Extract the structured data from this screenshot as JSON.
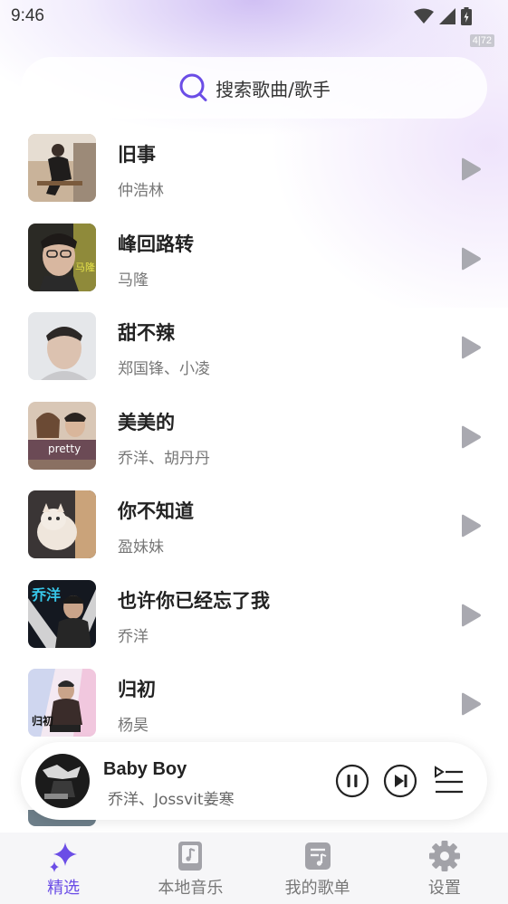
{
  "status": {
    "time": "9:46",
    "speed_badge": "4|72"
  },
  "search": {
    "placeholder": "搜索歌曲/歌手"
  },
  "songs": [
    {
      "title": "旧事",
      "artist": "仲浩林"
    },
    {
      "title": "峰回路转",
      "artist": "马隆"
    },
    {
      "title": "甜不辣",
      "artist": "郑国锋、小凌"
    },
    {
      "title": "美美的",
      "artist": "乔洋、胡丹丹"
    },
    {
      "title": "你不知道",
      "artist": "盈妹妹"
    },
    {
      "title": "也许你已经忘了我",
      "artist": "乔洋"
    },
    {
      "title": "归初",
      "artist": "杨昊"
    }
  ],
  "covers": {
    "c2": "马隆",
    "c4": "pretty",
    "c6": "乔洋",
    "c7": "归初"
  },
  "now_playing": {
    "title": "Baby Boy",
    "artist": "乔洋、Jossvit姜寒"
  },
  "nav": [
    {
      "label": "精选",
      "icon": "sparkle-icon",
      "active": true
    },
    {
      "label": "本地音乐",
      "icon": "local-music-icon",
      "active": false
    },
    {
      "label": "我的歌单",
      "icon": "playlist-icon",
      "active": false
    },
    {
      "label": "设置",
      "icon": "gear-icon",
      "active": false
    }
  ],
  "colors": {
    "accent": "#6b4de6",
    "play_icon": "#a9a9b0",
    "nav_icon": "#a2a2a8"
  }
}
